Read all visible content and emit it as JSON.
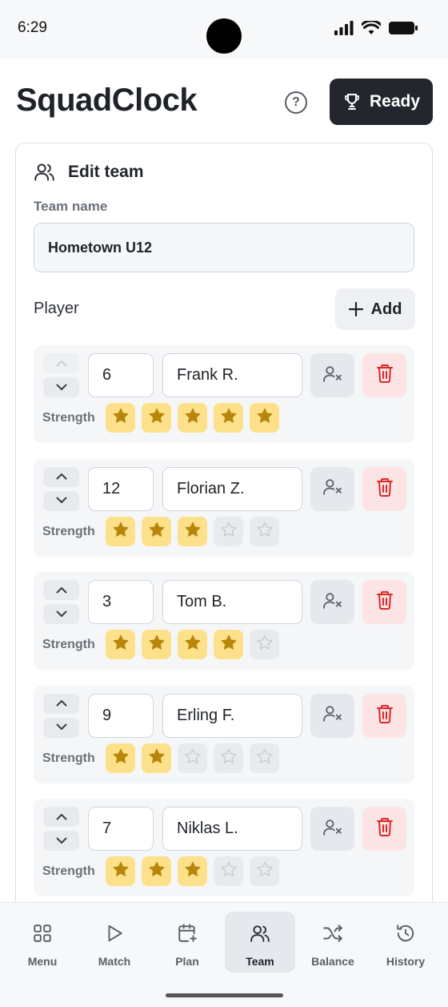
{
  "status_bar": {
    "time": "6:29"
  },
  "header": {
    "app_title": "SquadClock",
    "help_symbol": "?",
    "ready_label": "Ready"
  },
  "edit_team": {
    "title": "Edit team",
    "team_name_label": "Team name",
    "team_name_value": "Hometown U12",
    "player_label": "Player",
    "add_label": "Add",
    "strength_label": "Strength",
    "max_strength": 5,
    "players": [
      {
        "number": "6",
        "name": "Frank R.",
        "strength": 5
      },
      {
        "number": "12",
        "name": "Florian Z.",
        "strength": 3
      },
      {
        "number": "3",
        "name": "Tom B.",
        "strength": 4
      },
      {
        "number": "9",
        "name": "Erling F.",
        "strength": 2
      },
      {
        "number": "7",
        "name": "Niklas L.",
        "strength": 3
      }
    ]
  },
  "nav": {
    "items": [
      {
        "label": "Menu",
        "icon": "grid-icon"
      },
      {
        "label": "Match",
        "icon": "play-icon"
      },
      {
        "label": "Plan",
        "icon": "calendar-plus-icon"
      },
      {
        "label": "Team",
        "icon": "users-icon",
        "active": true
      },
      {
        "label": "Balance",
        "icon": "shuffle-icon"
      },
      {
        "label": "History",
        "icon": "history-icon"
      }
    ]
  },
  "colors": {
    "ready_button": "#23272d",
    "star_active_bg": "#fde08a",
    "star_active": "#b8860b",
    "delete_bg": "#fde4e4",
    "delete_icon": "#dc2626"
  }
}
